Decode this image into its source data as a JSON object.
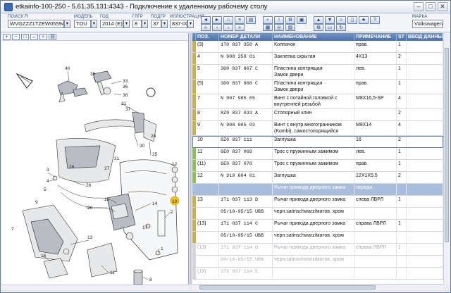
{
  "window": {
    "title": "etkainfo-100-250 - 5.61.35.131:4343 - Подключение к удаленному рабочему столу",
    "min": "–",
    "max": "□",
    "close": "✕"
  },
  "filters": {
    "vin": {
      "label": "ПОИСК FI",
      "value": "WVGZZZ1TZEW055941"
    },
    "model": {
      "label": "МОДЕЛЬ",
      "value": "TOU"
    },
    "year": {
      "label": "ГОД",
      "value": "2014 (E)"
    },
    "group": {
      "label": "ГЛГР",
      "value": "8"
    },
    "subgroup": {
      "label": "ПОДГР",
      "value": "37"
    },
    "illustration": {
      "label": "ИЛЛЮСТРАЦИЯ",
      "value": "837-000"
    },
    "brand": {
      "label": "МАРКА",
      "value": "Volkswagen"
    }
  },
  "columns": {
    "pos": "ПОЗ.",
    "part": "НОМЕР ДЕТАЛИ",
    "name": "НАИМЕНОВАНИЕ",
    "note": "ПРИМЕЧАНИЕ",
    "st": "ST",
    "input": "ВВОД ДАННЫХ"
  },
  "rows": [
    {
      "pos": "(3)",
      "part": "1T0 837 350 A",
      "name": "Колпачок",
      "note": "прав.",
      "st": "1",
      "marker": "#c8b24a",
      "style": ""
    },
    {
      "pos": "4",
      "part": "N  908 258 01",
      "name": "Заклепка скрытая",
      "note": "4X13",
      "st": "2",
      "marker": "#c8b24a",
      "style": ""
    },
    {
      "pos": "5",
      "part": "3D0 837 867 C",
      "name": "Пластина контрящая",
      "name2": "Замок двери",
      "note": "лев.",
      "st": "1",
      "marker": "#c8b24a",
      "style": ""
    },
    {
      "pos": "(5)",
      "part": "3D0 837 868 C",
      "name": "Пластина контрящая",
      "name2": "Замок двери",
      "note": "прав.",
      "st": "1",
      "marker": "#c8b24a",
      "style": ""
    },
    {
      "pos": "7",
      "part": "N  907 985 05",
      "name": "Винт с потайной головкой с",
      "name2": "внутренней резьбой",
      "note": "M8X16,5-SP",
      "st": "4",
      "marker": "#c8b24a",
      "style": ""
    },
    {
      "pos": "8",
      "part": "8Z0 837 033 A",
      "name": "Стопорный клин",
      "note": "",
      "st": "2",
      "marker": "#c8b24a",
      "style": ""
    },
    {
      "pos": "9",
      "part": "N  908 005 03",
      "name": "Винт с внутр.многогранником",
      "name2": "(Kombi), самостопорящийся",
      "note": "M8X14",
      "st": "4",
      "marker": "#c8b24a",
      "style": ""
    },
    {
      "pos": "10",
      "part": "8Z0 837 111",
      "name": "Заглушка",
      "note": "16",
      "st": "2",
      "marker": "#ffffff",
      "style": "sel"
    },
    {
      "pos": "11",
      "part": "6E0 837 069",
      "name": "Трос с пружинным зажимом",
      "note": "лев.",
      "st": "1",
      "marker": "#8fbf5a",
      "style": ""
    },
    {
      "pos": "(11)",
      "part": "6E0 837 070",
      "name": "Трос с пружинным зажимом",
      "note": "прав.",
      "st": "1",
      "marker": "#8fbf5a",
      "style": ""
    },
    {
      "pos": "12",
      "part": "N  910 604 01",
      "name": "Заглушка",
      "note": "12X1X5,5",
      "st": "2",
      "marker": "#8fbf5a",
      "style": ""
    },
    {
      "pos": "",
      "part": "",
      "name": "Рычаг привода дверного замка",
      "note": "передн.",
      "st": "",
      "marker": "#a9bedd",
      "style": "hdr"
    },
    {
      "pos": "13",
      "part": "1T1 837 113 D",
      "name": "Рычаг привода дверного замка",
      "note": "слева  ЛВРЛ",
      "st": "1",
      "marker": "#c8b24a",
      "style": ""
    },
    {
      "pos": "",
      "part": "05/10-05/15 UBB",
      "name": "черн.satinschwarz/матов. хром",
      "note": "",
      "st": "",
      "marker": "#c8b24a",
      "style": ""
    },
    {
      "pos": "(13)",
      "part": "1T1 837 114 C",
      "name": "Рычаг привода дверного замка",
      "note": "справа  ЛВРЛ",
      "st": "1",
      "marker": "#c8b24a",
      "style": ""
    },
    {
      "pos": "",
      "part": "05/10-05/15 UBB",
      "name": "черн.satinschwarz/матов. хром",
      "note": "",
      "st": "",
      "marker": "#c8b24a",
      "style": ""
    },
    {
      "pos": "(13)",
      "part": "1T1 837 114 D",
      "name": "Рычаг привода дверного замка",
      "note": "справа  ЛВРЛ",
      "st": "1",
      "marker": "#d6d6d6",
      "style": "dim"
    },
    {
      "pos": "",
      "part": "09/10-05/15 UBB",
      "name": "черн.satinschwarz/матов. хром",
      "note": "",
      "st": "",
      "marker": "#d6d6d6",
      "style": "dim"
    },
    {
      "pos": "(13)",
      "part": "1T1 837 114 E",
      "name": "",
      "note": "",
      "st": "",
      "marker": "#d6d6d6",
      "style": "dim"
    }
  ],
  "diagram": {
    "callouts": [
      "40",
      "35",
      "33",
      "36",
      "38",
      "31",
      "37",
      "30",
      "24",
      "25",
      "21",
      "27",
      "3",
      "28",
      "15",
      "4",
      "5",
      "26",
      "20",
      "9",
      "7",
      "14",
      "10",
      "13",
      "2",
      "12",
      "17",
      "16",
      "11",
      "1",
      "8"
    ],
    "highlight": "10"
  }
}
